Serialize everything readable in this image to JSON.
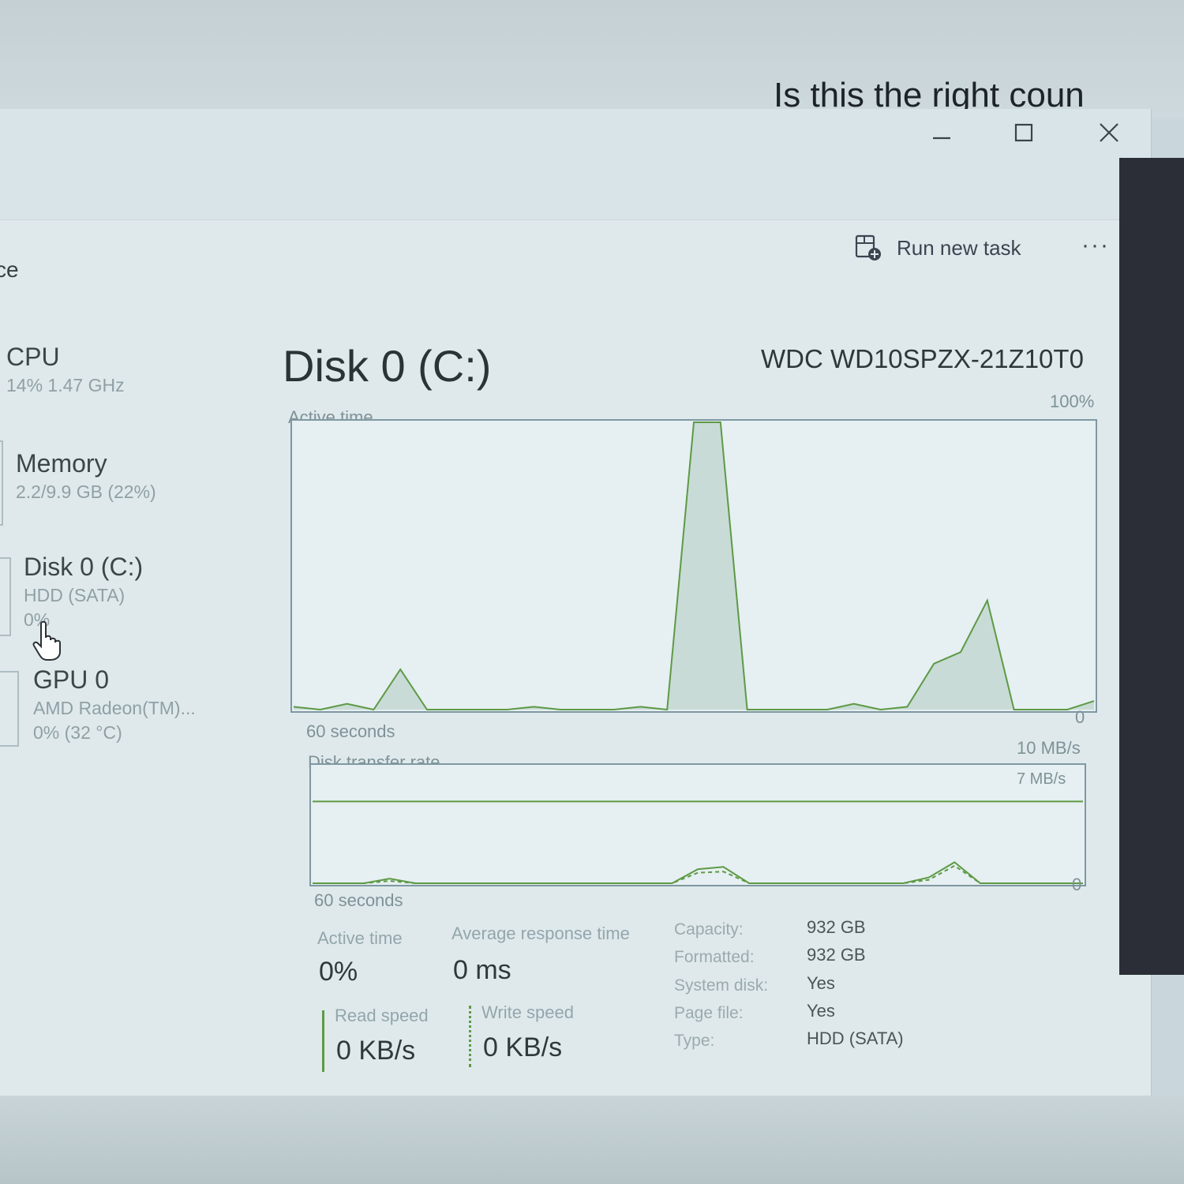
{
  "background": {
    "prompt_text": "Is this the right coun"
  },
  "window": {
    "controls": {
      "minimize": "—",
      "maximize": "☐",
      "close": "✕"
    },
    "page_label_fragment": "ce",
    "toolbar": {
      "run_new_task_label": "Run new task",
      "more_label": "···"
    }
  },
  "sidebar": {
    "items": [
      {
        "name": "CPU",
        "sub1": "14% 1.47 GHz"
      },
      {
        "name": "Memory",
        "sub1": "2.2/9.9 GB (22%)"
      },
      {
        "name": "Disk 0 (C:)",
        "sub1": "HDD (SATA)",
        "sub2": "0%"
      },
      {
        "name": "GPU 0",
        "sub1": "AMD Radeon(TM)...",
        "sub2": "0% (32 °C)"
      }
    ]
  },
  "detail": {
    "title": "Disk 0 (C:)",
    "model": "WDC WD10SPZX-21Z10T0",
    "active_chart": {
      "label": "Active time",
      "max_label": "100%",
      "min_label": "0",
      "time_label": "60 seconds"
    },
    "transfer_chart": {
      "label": "Disk transfer rate",
      "max_label": "10 MB/s",
      "line_label": "7 MB/s",
      "min_label": "0",
      "time_label": "60 seconds"
    },
    "stats": {
      "active_time_label": "Active time",
      "active_time_value": "0%",
      "avg_response_label": "Average response time",
      "avg_response_value": "0 ms",
      "read_speed_label": "Read speed",
      "read_speed_value": "0 KB/s",
      "write_speed_label": "Write speed",
      "write_speed_value": "0 KB/s"
    },
    "info": [
      {
        "key": "Capacity:",
        "value": "932 GB"
      },
      {
        "key": "Formatted:",
        "value": "932 GB"
      },
      {
        "key": "System disk:",
        "value": "Yes"
      },
      {
        "key": "Page file:",
        "value": "Yes"
      },
      {
        "key": "Type:",
        "value": "HDD (SATA)"
      }
    ]
  },
  "colors": {
    "graph_line": "#5d9a45",
    "graph_fill": "#c9dbd6",
    "graph_border": "#7f98a2"
  },
  "chart_data": [
    {
      "type": "area",
      "title": "Active time",
      "xlabel": "60 seconds",
      "ylim": [
        0,
        100
      ],
      "x": [
        0,
        2,
        4,
        6,
        8,
        10,
        12,
        14,
        16,
        18,
        20,
        22,
        24,
        26,
        28,
        30,
        32,
        34,
        36,
        38,
        40,
        42,
        44,
        46,
        48,
        50,
        52,
        54,
        56,
        58,
        60
      ],
      "series": [
        {
          "values": [
            1,
            0,
            2,
            0,
            14,
            0,
            0,
            0,
            0,
            1,
            0,
            0,
            0,
            1,
            0,
            100,
            100,
            0,
            0,
            0,
            0,
            2,
            0,
            1,
            16,
            20,
            38,
            0,
            0,
            0,
            3
          ]
        }
      ]
    },
    {
      "type": "line",
      "title": "Disk transfer rate",
      "xlabel": "60 seconds",
      "ylim": [
        0,
        10
      ],
      "reference_line": 7,
      "x": [
        0,
        2,
        4,
        6,
        8,
        10,
        12,
        14,
        16,
        18,
        20,
        22,
        24,
        26,
        28,
        30,
        32,
        34,
        36,
        38,
        40,
        42,
        44,
        46,
        48,
        50,
        52,
        54,
        56,
        58,
        60
      ],
      "series": [
        {
          "values": [
            0,
            0,
            0,
            0.4,
            0,
            0,
            0,
            0,
            0,
            0,
            0,
            0,
            0,
            0,
            0,
            1.2,
            1.4,
            0,
            0,
            0,
            0,
            0,
            0,
            0,
            0.5,
            1.8,
            0,
            0,
            0,
            0,
            0
          ]
        },
        {
          "values": [
            0,
            0,
            0,
            0.2,
            0,
            0,
            0,
            0,
            0,
            0,
            0,
            0,
            0,
            0,
            0,
            0.9,
            1.0,
            0,
            0,
            0,
            0,
            0,
            0,
            0,
            0.3,
            1.5,
            0,
            0,
            0,
            0,
            0
          ]
        }
      ]
    }
  ]
}
